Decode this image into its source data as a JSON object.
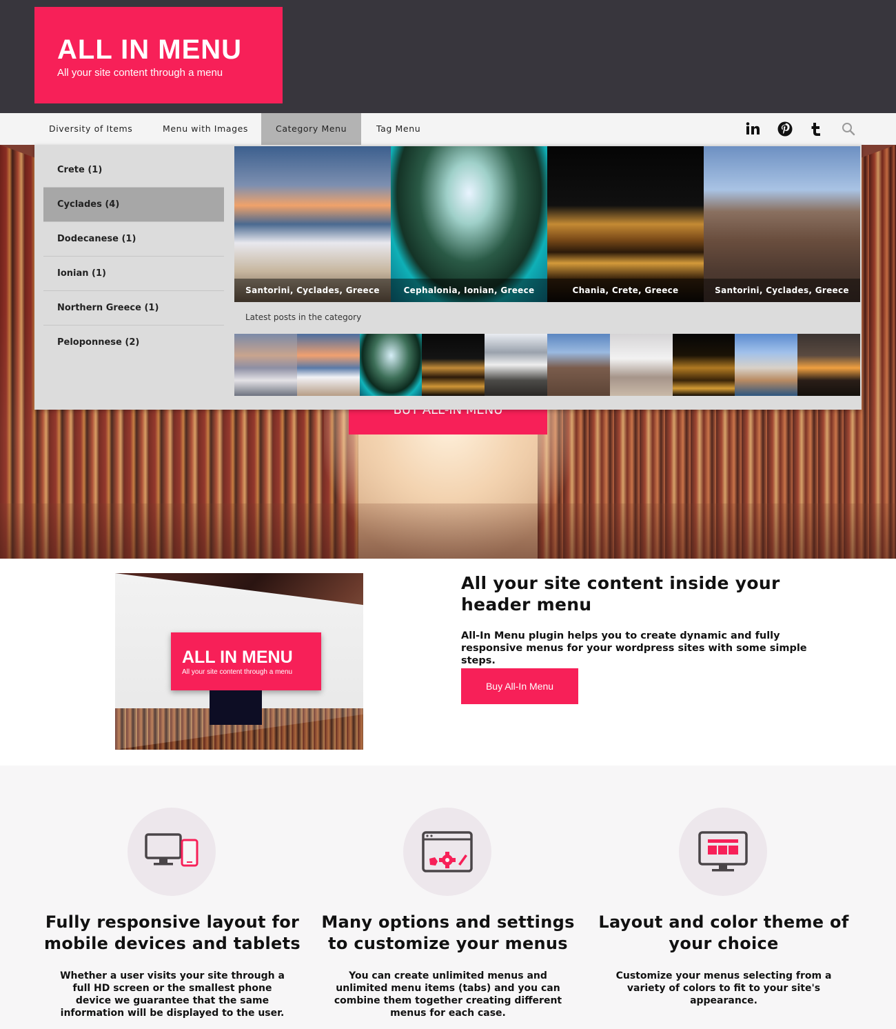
{
  "brand": {
    "title": "ALL IN MENU",
    "tagline": "All your site content through a menu",
    "accent_color": "#f72058",
    "header_bg": "#38363d"
  },
  "nav": {
    "items": [
      {
        "label": "Diversity of Items"
      },
      {
        "label": "Menu with Images"
      },
      {
        "label": "Category Menu",
        "active": true
      },
      {
        "label": "Tag Menu"
      }
    ],
    "social": [
      "linkedin-icon",
      "pinterest-icon",
      "tumblr-icon",
      "search-icon"
    ]
  },
  "dropdown": {
    "categories": [
      {
        "label": "Crete (1)"
      },
      {
        "label": "Cyclades (4)",
        "active": true
      },
      {
        "label": "Dodecanese (1)"
      },
      {
        "label": "Ionian (1)"
      },
      {
        "label": "Northern Greece (1)"
      },
      {
        "label": "Peloponnese (2)"
      }
    ],
    "featured": [
      {
        "caption": "Santorini, Cyclades, Greece"
      },
      {
        "caption": "Cephalonia, Ionian, Greece"
      },
      {
        "caption": "Chania, Crete, Greece"
      },
      {
        "caption": "Santorini, Cyclades, Greece"
      }
    ],
    "latest_label": "Latest posts in the category",
    "thumbnail_count": 10
  },
  "hero": {
    "button_label": "BUY ALL-IN MENU"
  },
  "intro": {
    "heading": "All your site content inside your header menu",
    "body": "All-In Menu plugin helps you to create dynamic and fully responsive menus for your wordpress sites with some simple steps.",
    "button_label": "Buy All-In Menu",
    "screenshot": {
      "title": "ALL IN MENU",
      "tagline": "All your site content through a menu"
    }
  },
  "features": [
    {
      "icon": "responsive-devices-icon",
      "title": "Fully responsive layout for mobile devices and tablets",
      "body": "Whether a user visits your site through a full HD screen or the smallest phone device we guarantee that the same information will be displayed to the user."
    },
    {
      "icon": "settings-window-icon",
      "title": "Many options and settings to customize your menus",
      "body": "You can create unlimited menus and unlimited menu items (tabs) and you can combine them together creating different menus for each case."
    },
    {
      "icon": "layout-monitor-icon",
      "title": "Layout and color theme of your choice",
      "body": "Customize your menus selecting from a variety of colors to fit to your site's appearance."
    }
  ]
}
